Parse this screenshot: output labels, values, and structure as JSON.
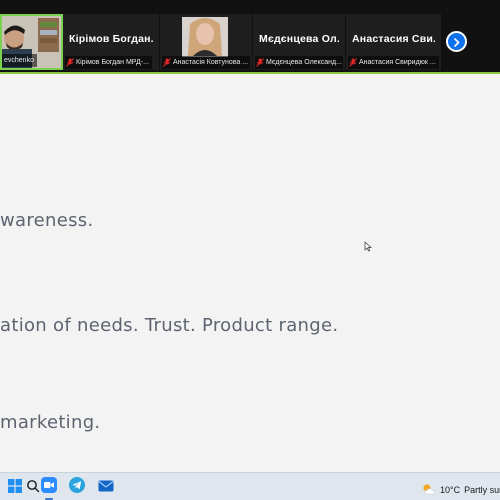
{
  "participants": [
    {
      "name": "evchenko",
      "video": true,
      "active": true
    },
    {
      "display_name": "Кірімов Богдан...",
      "name": "Кірімов Богдан МРД-...",
      "video": false,
      "muted": true
    },
    {
      "name": "Анастасія Ковтунова ...",
      "video": true,
      "muted": true
    },
    {
      "display_name": "Мєдєнцева Ол...",
      "name": "Мєдєнцева Олександ...",
      "video": false,
      "muted": true
    },
    {
      "display_name": "Анастасия Сви...",
      "name": "Анастасия Свиридюк ...",
      "video": false,
      "muted": true
    }
  ],
  "slide": {
    "lines": [
      "wareness.",
      "ation of needs. Trust. Product range.",
      "marketing."
    ]
  },
  "taskbar": {
    "weather": {
      "temp": "10°C",
      "desc": "Partly sunny"
    },
    "icons": [
      "start-icon",
      "search-icon",
      "zoom-icon",
      "telegram-icon",
      "mail-icon"
    ]
  },
  "colors": {
    "accent_green": "#7bd24e",
    "zoom_blue": "#0e72ed",
    "slide_text": "#5d6470"
  }
}
